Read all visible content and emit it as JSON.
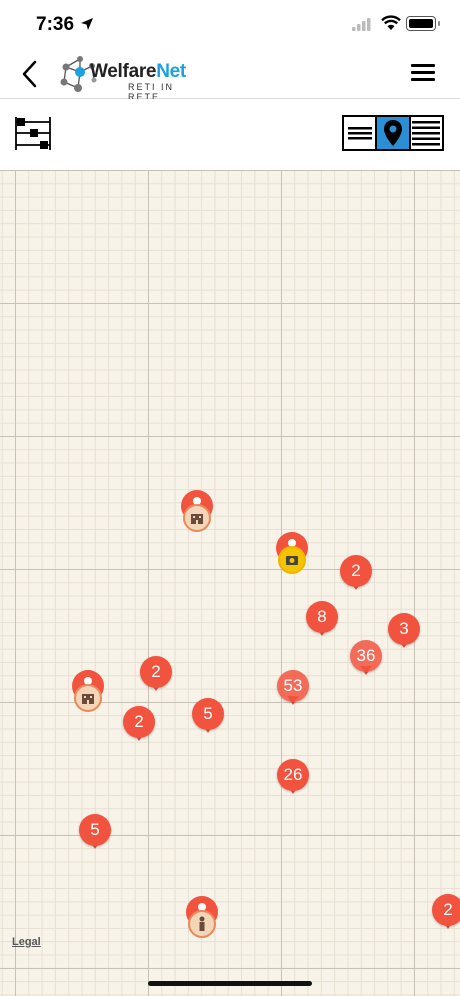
{
  "status_bar": {
    "time": "7:36"
  },
  "header": {
    "logo_main": "Welfare",
    "logo_accent": "Net",
    "logo_subtitle": "RETI IN RETE"
  },
  "map": {
    "clusters": [
      {
        "count": "2"
      },
      {
        "count": "8"
      },
      {
        "count": "3"
      },
      {
        "count": "36"
      },
      {
        "count": "53"
      },
      {
        "count": "2"
      },
      {
        "count": "2"
      },
      {
        "count": "5"
      },
      {
        "count": "26"
      },
      {
        "count": "5"
      },
      {
        "count": "2"
      }
    ],
    "legal_link": "Legal"
  },
  "colors": {
    "marker": "#f2533f",
    "accent": "#1ba1e2",
    "active_view": "#2b8fd6",
    "map_bg": "#f8f3e8"
  }
}
